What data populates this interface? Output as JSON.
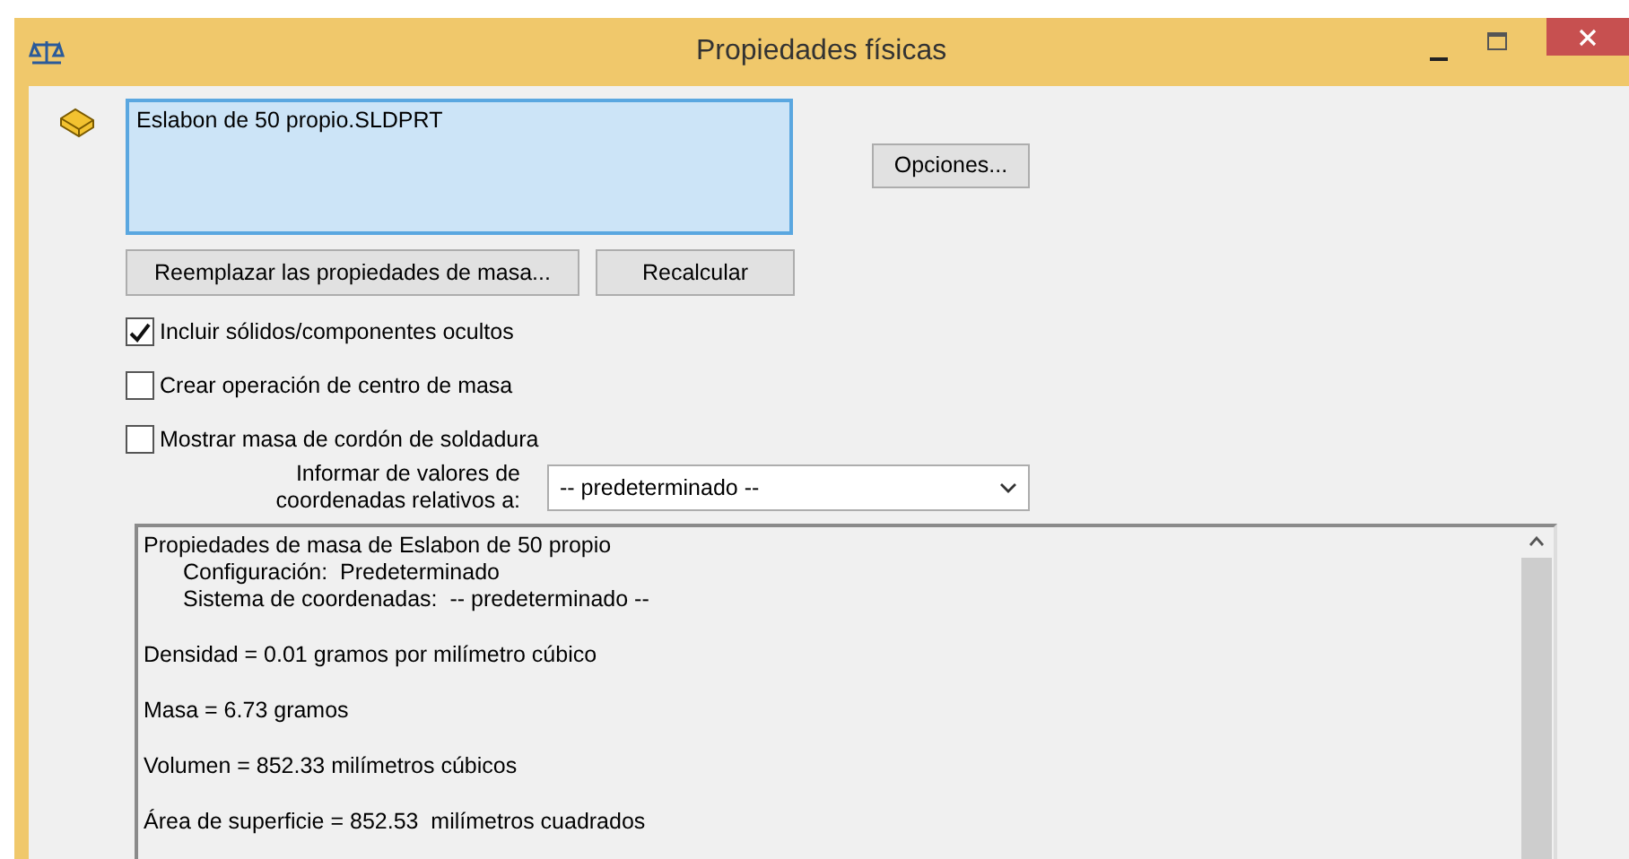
{
  "window": {
    "title": "Propiedades físicas"
  },
  "selection": {
    "items": [
      "Eslabon de 50 propio.SLDPRT"
    ]
  },
  "buttons": {
    "options": "Opciones...",
    "override": "Reemplazar las propiedades de masa...",
    "recalculate": "Recalcular"
  },
  "checkboxes": [
    {
      "label": "Incluir sólidos/componentes ocultos",
      "checked": true
    },
    {
      "label": "Crear operación de centro de masa",
      "checked": false
    },
    {
      "label": "Mostrar masa de cordón de soldadura",
      "checked": false
    }
  ],
  "coordinate_select": {
    "label": "Informar de valores de coordenadas relativos a:",
    "value": "-- predeterminado --"
  },
  "report": {
    "lines": [
      {
        "kind": "title",
        "text": "Propiedades de masa de Eslabon de 50 propio"
      },
      {
        "kind": "detail",
        "text": "Configuración:  Predeterminado"
      },
      {
        "kind": "detail",
        "text": "Sistema de coordenadas:  -- predeterminado --"
      },
      {
        "kind": "value",
        "text": "Densidad = 0.01 gramos por milímetro cúbico"
      },
      {
        "kind": "value",
        "text": "Masa = 6.73 gramos"
      },
      {
        "kind": "value",
        "text": "Volumen = 852.33 milímetros cúbicos"
      },
      {
        "kind": "value",
        "text": "Área de superficie = 852.53  milímetros cuadrados"
      }
    ]
  }
}
